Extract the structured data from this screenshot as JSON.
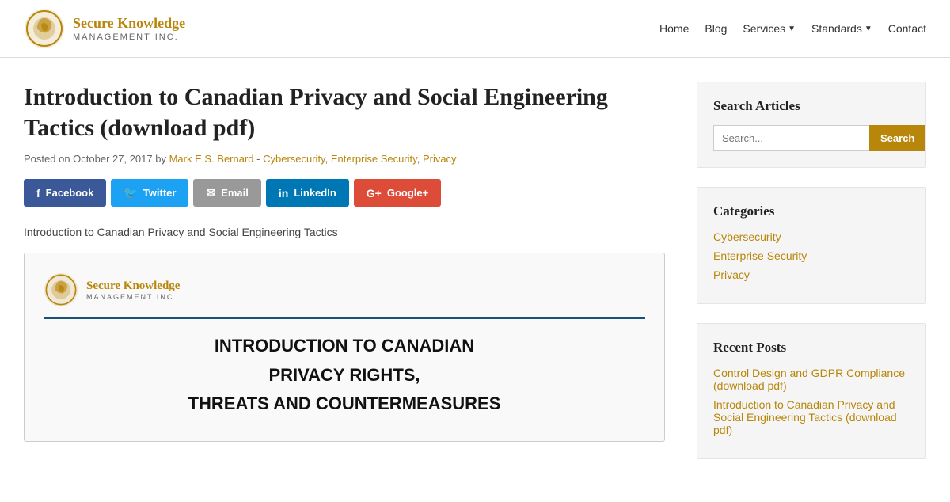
{
  "header": {
    "logo_name": "Secure Knowledge",
    "logo_sub": "MANAGEMENT INC.",
    "nav": [
      {
        "label": "Home",
        "href": "#",
        "dropdown": false
      },
      {
        "label": "Blog",
        "href": "#",
        "dropdown": false
      },
      {
        "label": "Services",
        "href": "#",
        "dropdown": true
      },
      {
        "label": "Standards",
        "href": "#",
        "dropdown": true
      },
      {
        "label": "Contact",
        "href": "#",
        "dropdown": false
      }
    ]
  },
  "article": {
    "title": "Introduction to Canadian Privacy and Social Engineering Tactics (download pdf)",
    "meta_prefix": "Posted on October 27, 2017 by",
    "author": "Mark E.S. Bernard",
    "categories_meta": "Cybersecurity, Enterprise Security, Privacy",
    "intro": "Introduction to Canadian Privacy and Social Engineering Tactics"
  },
  "share": {
    "facebook": "Facebook",
    "twitter": "Twitter",
    "email": "Email",
    "linkedin": "LinkedIn",
    "googleplus": "Google+"
  },
  "pdf_preview": {
    "logo_name": "Secure Knowledge",
    "logo_sub": "MANAGEMENT INC.",
    "line1": "INTRODUCTION TO CANADIAN",
    "line2": "PRIVACY RIGHTS,",
    "line3": "THREATS AND COUNTERMEASURES"
  },
  "sidebar": {
    "search": {
      "title": "Search Articles",
      "placeholder": "Search...",
      "button": "Search"
    },
    "categories": {
      "title": "Categories",
      "items": [
        {
          "label": "Cybersecurity",
          "href": "#"
        },
        {
          "label": "Enterprise Security",
          "href": "#"
        },
        {
          "label": "Privacy",
          "href": "#"
        }
      ]
    },
    "recent": {
      "title": "Recent Posts",
      "items": [
        {
          "label": "Control Design and GDPR Compliance (download pdf)",
          "href": "#"
        },
        {
          "label": "Introduction to Canadian Privacy and Social Engineering Tactics (download pdf)",
          "href": "#"
        }
      ]
    }
  }
}
